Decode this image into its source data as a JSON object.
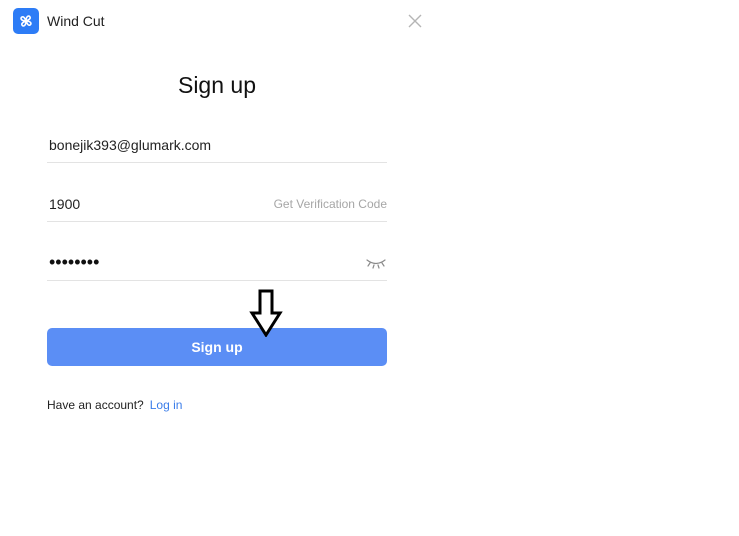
{
  "window": {
    "title": "Wind Cut",
    "logo_icon": "pinwheel-icon",
    "close_icon": "close-icon"
  },
  "form": {
    "heading": "Sign up",
    "email_value": "bonejik393@glumark.com",
    "code_value": "1900",
    "get_code_label": "Get Verification Code",
    "password_masked": "••••••••",
    "eye_icon": "eye-closed-icon",
    "submit_label": "Sign up"
  },
  "footer": {
    "prompt": "Have an account?",
    "login_label": "Log in"
  },
  "annotation": {
    "icon": "arrow-down-icon"
  },
  "colors": {
    "accent": "#5b8ef5",
    "link": "#3b7de9",
    "logo_bg": "#2d7cf6",
    "muted": "#a6a6a6"
  }
}
